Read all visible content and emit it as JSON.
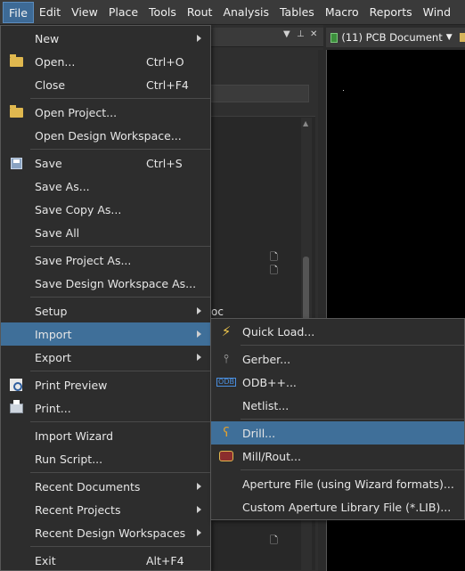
{
  "menubar": {
    "items": [
      "File",
      "Edit",
      "View",
      "Place",
      "Tools",
      "Rout",
      "Analysis",
      "Tables",
      "Macro",
      "Reports",
      "Wind"
    ]
  },
  "document_tab": {
    "title": "(11) PCB Document"
  },
  "panel": {
    "partial_text": "oc"
  },
  "file_menu": {
    "new": "New",
    "open": "Open...",
    "open_shortcut": "Ctrl+O",
    "close": "Close",
    "close_shortcut": "Ctrl+F4",
    "open_project": "Open Project...",
    "open_design_workspace": "Open Design Workspace...",
    "save": "Save",
    "save_shortcut": "Ctrl+S",
    "save_as": "Save As...",
    "save_copy_as": "Save Copy As...",
    "save_all": "Save All",
    "save_project_as": "Save Project As...",
    "save_design_workspace_as": "Save Design Workspace As...",
    "setup": "Setup",
    "import": "Import",
    "export": "Export",
    "print_preview": "Print Preview",
    "print": "Print...",
    "import_wizard": "Import Wizard",
    "run_script": "Run Script...",
    "recent_documents": "Recent Documents",
    "recent_projects": "Recent Projects",
    "recent_design_workspaces": "Recent Design Workspaces",
    "exit": "Exit",
    "exit_shortcut": "Alt+F4"
  },
  "import_menu": {
    "quick_load": "Quick Load...",
    "gerber": "Gerber...",
    "odb": "ODB++...",
    "netlist": "Netlist...",
    "drill": "Drill...",
    "mill_rout": "Mill/Rout...",
    "aperture_file": "Aperture File (using Wizard formats)...",
    "custom_aperture": "Custom Aperture Library File (*.LIB)..."
  }
}
